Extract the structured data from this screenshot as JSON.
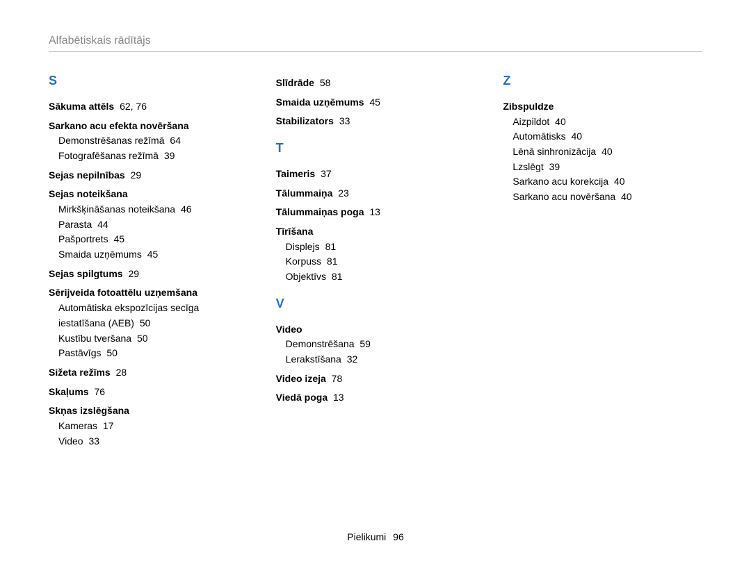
{
  "header": "Alfabētiskais rādītājs",
  "footer": {
    "label": "Pielikumi",
    "page": "96"
  },
  "columns": [
    {
      "sections": [
        {
          "letter": "S",
          "entries": [
            {
              "label": "Sākuma attēls",
              "pages": "62, 76"
            },
            {
              "label": "Sarkano acu efekta novēršana",
              "subs": [
                {
                  "label": "Demonstrēšanas režīmā",
                  "pages": "64"
                },
                {
                  "label": "Fotografēšanas režīmā",
                  "pages": "39"
                }
              ]
            },
            {
              "label": "Sejas nepilnības",
              "pages": "29"
            },
            {
              "label": "Sejas noteikšana",
              "subs": [
                {
                  "label": "Mirkšķināšanas noteikšana",
                  "pages": "46"
                },
                {
                  "label": "Parasta",
                  "pages": "44"
                },
                {
                  "label": "Pašportrets",
                  "pages": "45"
                },
                {
                  "label": "Smaida uzņēmums",
                  "pages": "45"
                }
              ]
            },
            {
              "label": "Sejas spilgtums",
              "pages": "29"
            },
            {
              "label": "Sērijveida fotoattēlu uzņemšana",
              "subs": [
                {
                  "label": "Automātiska ekspozīcijas secīga iestatīšana (AEB)",
                  "pages": "50"
                },
                {
                  "label": "Kustību tveršana",
                  "pages": "50"
                },
                {
                  "label": "Pastāvīgs",
                  "pages": "50"
                }
              ]
            },
            {
              "label": "Sižeta režīms",
              "pages": "28"
            },
            {
              "label": "Skaļums",
              "pages": "76"
            },
            {
              "label": "Skņas izslēgšana",
              "subs": [
                {
                  "label": "Kameras",
                  "pages": "17"
                },
                {
                  "label": "Video",
                  "pages": "33"
                }
              ]
            }
          ]
        }
      ]
    },
    {
      "sections": [
        {
          "letter": "",
          "entries": [
            {
              "label": "Slīdrāde",
              "pages": "58"
            },
            {
              "label": "Smaida uzņēmums",
              "pages": "45"
            },
            {
              "label": "Stabilizators",
              "pages": "33"
            }
          ]
        },
        {
          "letter": "T",
          "entries": [
            {
              "label": "Taimeris",
              "pages": "37"
            },
            {
              "label": "Tālummaiņa",
              "pages": "23"
            },
            {
              "label": "Tālummaiņas poga",
              "pages": "13"
            },
            {
              "label": "Tīrīšana",
              "subs": [
                {
                  "label": "Displejs",
                  "pages": "81"
                },
                {
                  "label": "Korpuss",
                  "pages": "81"
                },
                {
                  "label": "Objektīvs",
                  "pages": "81"
                }
              ]
            }
          ]
        },
        {
          "letter": "V",
          "entries": [
            {
              "label": "Video",
              "subs": [
                {
                  "label": "Demonstrēšana",
                  "pages": "59"
                },
                {
                  "label": "Lerakstīšana",
                  "pages": "32"
                }
              ]
            },
            {
              "label": "Video izeja",
              "pages": "78"
            },
            {
              "label": "Viedā poga",
              "pages": "13"
            }
          ]
        }
      ]
    },
    {
      "sections": [
        {
          "letter": "Z",
          "entries": [
            {
              "label": "Zibspuldze",
              "subs": [
                {
                  "label": "Aizpildot",
                  "pages": "40"
                },
                {
                  "label": "Automātisks",
                  "pages": "40"
                },
                {
                  "label": "Lēnā sinhronizācija",
                  "pages": "40"
                },
                {
                  "label": "Lzslēgt",
                  "pages": "39"
                },
                {
                  "label": "Sarkano acu korekcija",
                  "pages": "40"
                },
                {
                  "label": "Sarkano acu novēršana",
                  "pages": "40"
                }
              ]
            }
          ]
        }
      ]
    }
  ]
}
